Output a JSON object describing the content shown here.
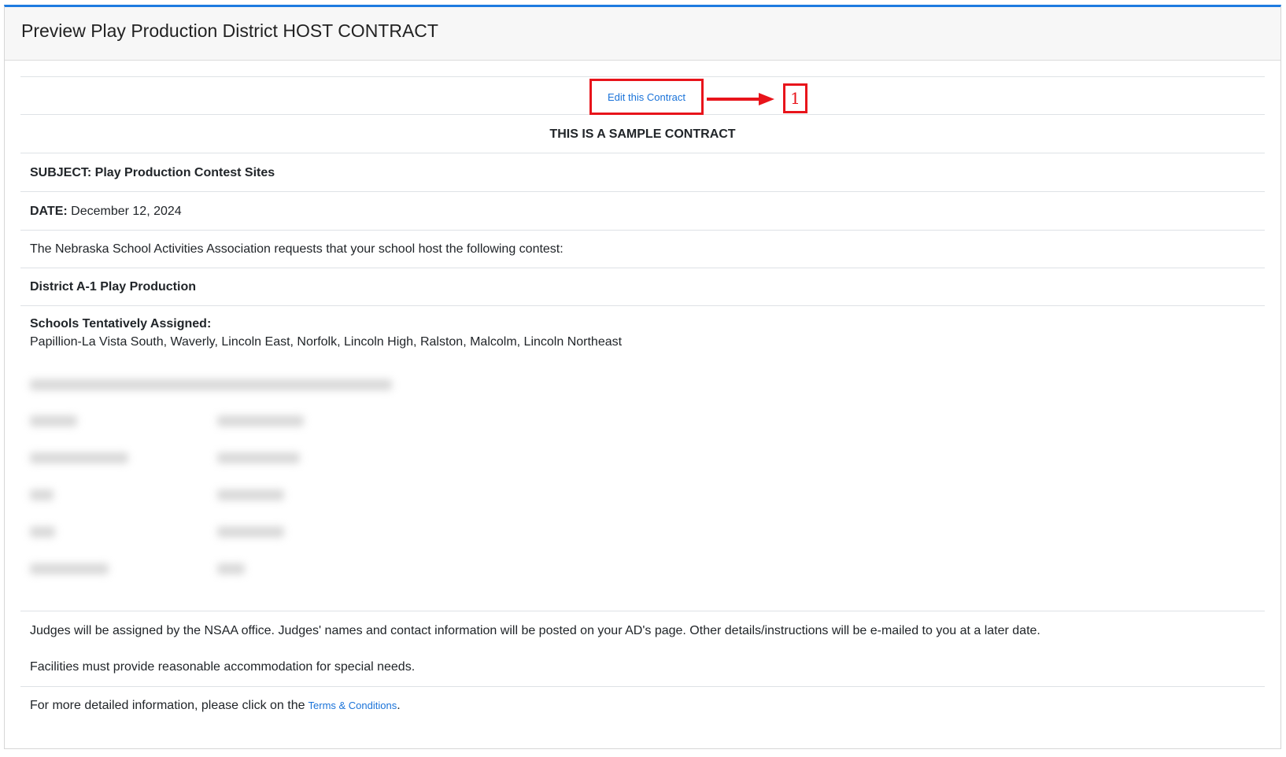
{
  "header": {
    "title": "Preview Play Production District HOST CONTRACT"
  },
  "edit": {
    "link_label": "Edit this Contract",
    "callout_number": "1"
  },
  "contract": {
    "sample_notice": "THIS IS A SAMPLE CONTRACT",
    "subject": "SUBJECT: Play Production Contest Sites",
    "date_label": "DATE:",
    "date_value": "December 12, 2024",
    "request_text": "The Nebraska School Activities Association requests that your school host the following contest:",
    "contest_name": "District A-1 Play Production",
    "schools_heading": "Schools Tentatively Assigned:",
    "schools_list": "Papillion-La Vista South, Waverly, Lincoln East, Norfolk, Lincoln High, Ralston, Malcolm, Lincoln Northeast",
    "judges_text": "Judges will be assigned by the NSAA office. Judges' names and contact information will be posted on your AD's page. Other details/instructions will be e-mailed to you at a later date.",
    "facilities_text": "Facilities must provide reasonable accommodation for special needs.",
    "terms_prefix": "For more detailed information, please click on the",
    "terms_link": "Terms & Conditions",
    "terms_suffix": "."
  },
  "colors": {
    "accent_blue": "#1e7be0",
    "link_blue": "#1a73d9",
    "annotation_red": "#e8141b"
  }
}
